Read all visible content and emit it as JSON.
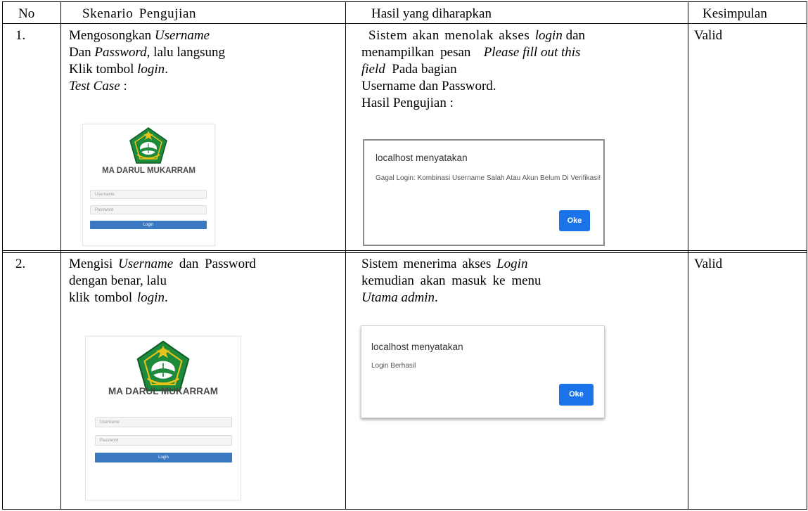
{
  "headers": {
    "no": "No",
    "skenario": "Skenario Pengujian",
    "hasil": "Hasil yang diharapkan",
    "kesimpulan": "Kesimpulan"
  },
  "rows": [
    {
      "no": "1.",
      "skenario": {
        "l1_a": "Mengosongkan ",
        "l1_b": "Username",
        "l2_a": "Dan ",
        "l2_b": "Password",
        "l2_c": ", lalu langsung",
        "l3_a": "Klik tombol ",
        "l3_b": "login",
        "l3_c": ".",
        "l4_a": "Test Case",
        "l4_b": " :"
      },
      "hasil": {
        "l1_a": "Sistem akan menolak akses ",
        "l1_b": "login",
        "l1_c": " dan",
        "l2_a": "menampilkan pesan ",
        "l2_b": "Please fill out this",
        "l3_a": "field",
        "l3_b": " Pada bagian",
        "l4": "Username dan Password.",
        "l5": "Hasil Pengujian :"
      },
      "kesimpulan": "Valid",
      "login": {
        "school": "MA DARUL MUKARRAM",
        "username_placeholder": "Username",
        "password_placeholder": "Password",
        "button": "Login"
      },
      "dialog": {
        "title": "localhost menyatakan",
        "message": "Gagal Login: Kombinasi Username Salah Atau Akun Belum Di Verifikasi!",
        "ok": "Oke"
      }
    },
    {
      "no": "2.",
      "skenario": {
        "l1_a": "Mengisi ",
        "l1_b": "Username",
        "l1_c": " dan Password",
        "l2": "dengan benar,  lalu",
        "l3_a": "klik tombol ",
        "l3_b": "login",
        "l3_c": "."
      },
      "hasil": {
        "l1_a": "Sistem menerima akses ",
        "l1_b": "Login",
        "l2": "kemudian akan masuk ke menu",
        "l3_a": "Utama admin",
        "l3_b": "."
      },
      "kesimpulan": "Valid",
      "login": {
        "school": "MA DARUL MUKARRAM",
        "username_placeholder": "Username",
        "password_placeholder": "Password",
        "button": "Login"
      },
      "dialog": {
        "title": "localhost menyatakan",
        "message": "Login Berhasil",
        "ok": "Oke"
      }
    }
  ],
  "colors": {
    "logo_green": "#1e8a3c",
    "logo_gold": "#e8c21a",
    "login_button": "#3b78c2",
    "ok_button": "#1a73e8"
  },
  "icons": [
    "kemenag-logo-icon"
  ]
}
